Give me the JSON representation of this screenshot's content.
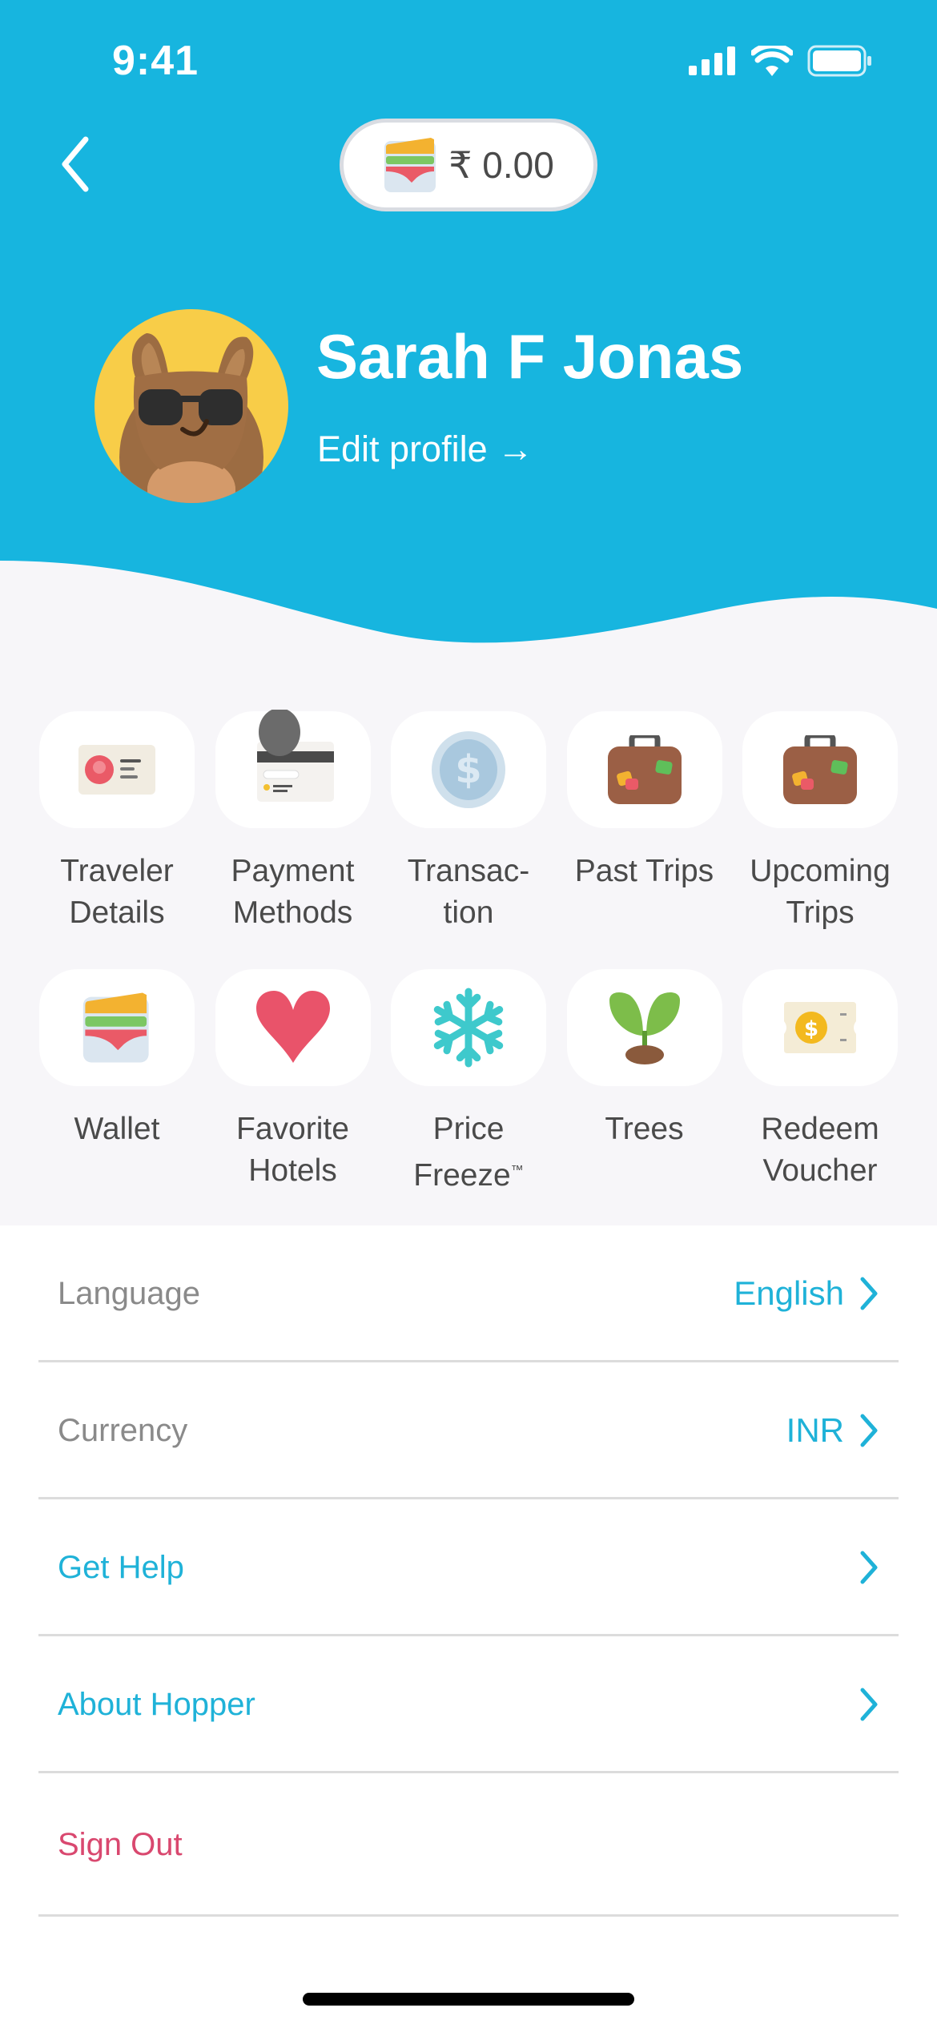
{
  "status_bar": {
    "time": "9:41"
  },
  "colors": {
    "brand": "#17b5df",
    "accent_text": "#1fb2d8",
    "danger": "#d9486f",
    "avatar_bg": "#f8cd48"
  },
  "header": {
    "back_icon": "chevron-left-icon",
    "wallet": {
      "icon": "wallet-icon",
      "amount": "₹ 0.00"
    },
    "profile": {
      "name": "Sarah F Jonas",
      "edit_label": "Edit profile →",
      "avatar": "bunny-with-sunglasses-avatar"
    }
  },
  "grid": {
    "rows": [
      [
        {
          "label": "Traveler\nDetails",
          "icon": "id-card-icon"
        },
        {
          "label": "Payment\nMethods",
          "icon": "credit-card-icon"
        },
        {
          "label": "Transac-\ntion",
          "icon": "dollar-coin-icon"
        },
        {
          "label": "Past Trips",
          "icon": "suitcase-icon"
        },
        {
          "label": "Upcoming\nTrips",
          "icon": "suitcase-icon"
        }
      ],
      [
        {
          "label": "Wallet",
          "icon": "wallet-icon"
        },
        {
          "label": "Favorite\nHotels",
          "icon": "heart-icon"
        },
        {
          "label": "Price\nFreeze",
          "label_suffix": "™",
          "icon": "snowflake-icon"
        },
        {
          "label": "Trees",
          "icon": "sprout-icon"
        },
        {
          "label": "Redeem\nVoucher",
          "icon": "voucher-icon"
        }
      ]
    ]
  },
  "settings": {
    "language": {
      "label": "Language",
      "value": "English"
    },
    "currency": {
      "label": "Currency",
      "value": "INR"
    },
    "help": {
      "label": "Get Help"
    },
    "about": {
      "label": "About Hopper"
    },
    "sign_out": {
      "label": "Sign Out"
    }
  }
}
